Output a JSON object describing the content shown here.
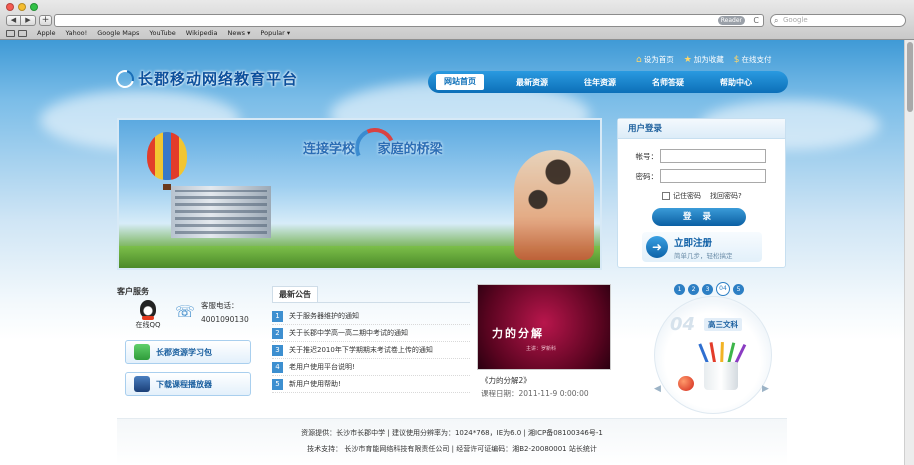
{
  "browser": {
    "back_label": "◀",
    "forward_label": "▶",
    "new_tab_label": "+",
    "reader_label": "Reader",
    "reload_label": "C",
    "search_placeholder": "Google",
    "bookmarks": [
      "Apple",
      "Yahoo!",
      "Google Maps",
      "YouTube",
      "Wikipedia",
      "News ▾",
      "Popular ▾"
    ]
  },
  "header": {
    "links": [
      "设为首页",
      "加为收藏",
      "在线支付"
    ],
    "logo_text": "长郡移动网络教育平台"
  },
  "nav": {
    "items": [
      "网站首页",
      "最新资源",
      "往年资源",
      "名师答疑",
      "帮助中心"
    ]
  },
  "banner": {
    "slogan_left": "连接学校",
    "slogan_right": "家庭的桥梁"
  },
  "login": {
    "title": "用户登录",
    "account_label": "帐号：",
    "password_label": "密码：",
    "account_value": "",
    "password_value": "",
    "remember_label": "记住密码",
    "forgot_label": "找回密码?",
    "login_button": "登 录",
    "register_main": "立即注册",
    "register_sub": "简单几步，轻松搞定"
  },
  "service": {
    "title": "客户服务",
    "qq_label": "在线QQ",
    "phone_label": "客服电话：",
    "phone_number": "4001090130",
    "button_resource_pack": "长郡资源学习包",
    "button_player": "下载课程播放器"
  },
  "announcements": {
    "tab": "最新公告",
    "items": [
      {
        "num": "1",
        "text": "关于服务器维护的通知"
      },
      {
        "num": "2",
        "text": "关于长郡中学高一高二期中考试的通知"
      },
      {
        "num": "3",
        "text": "关于推迟2010年下学期期末考试卷上传的通知"
      },
      {
        "num": "4",
        "text": "老用户使用平台说明!"
      },
      {
        "num": "5",
        "text": "新用户使用帮助!"
      }
    ]
  },
  "video": {
    "title": "力的分解",
    "subtitle": "主讲：罗新科",
    "caption": "《力的分解2》",
    "date": "课程日期：2011-11-9 0:00:00"
  },
  "grade_widget": {
    "dots": [
      "1",
      "2",
      "3",
      "04",
      "5"
    ],
    "big_number": "04",
    "label": "高三文科"
  },
  "footer": {
    "line1": "资源提供：长沙市长郡中学 | 建议使用分辨率为：1024*768，IE为6.0 | 湘ICP备08100346号-1",
    "line2": "技术支持： 长沙市育能网络科技有限责任公司 | 经营许可证编码：湘B2-20080001 站长统计"
  },
  "colors": {
    "brand_blue": "#0c6fb8",
    "logo_text": "#0b4f9c",
    "accent_red": "#d94242"
  }
}
